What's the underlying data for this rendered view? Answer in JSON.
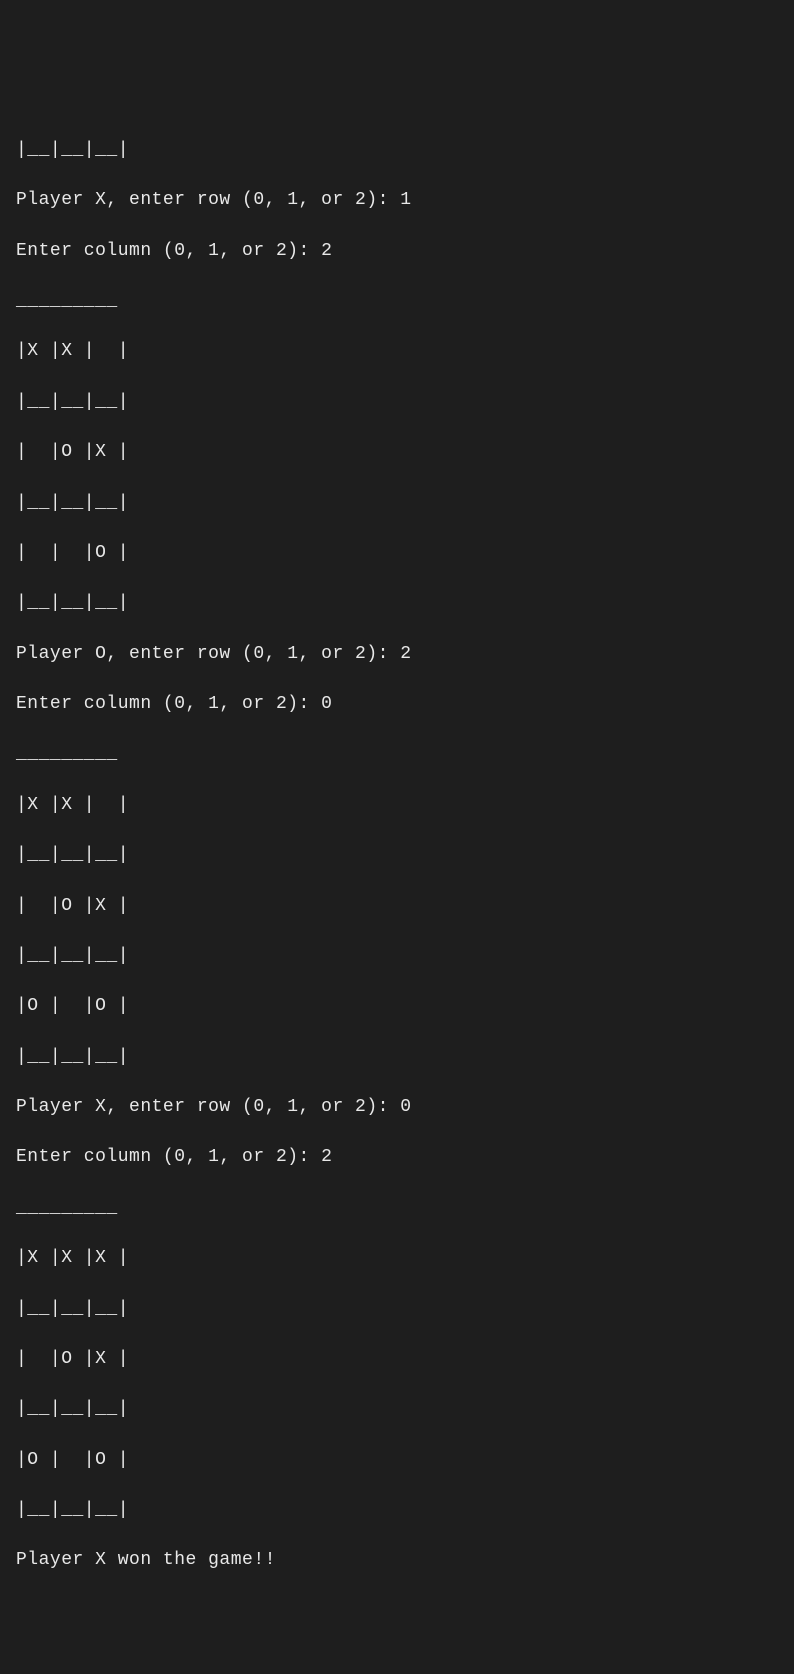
{
  "terminal": {
    "lines": [
      "|__|__|__|",
      "Player X, enter row (0, 1, or 2): 1",
      "Enter column (0, 1, or 2): 2",
      "_________",
      "|X |X |  |",
      "|__|__|__|",
      "|  |O |X |",
      "|__|__|__|",
      "|  |  |O |",
      "|__|__|__|",
      "Player O, enter row (0, 1, or 2): 2",
      "Enter column (0, 1, or 2): 0",
      "_________",
      "|X |X |  |",
      "|__|__|__|",
      "|  |O |X |",
      "|__|__|__|",
      "|O |  |O |",
      "|__|__|__|",
      "Player X, enter row (0, 1, or 2): 0",
      "Enter column (0, 1, or 2): 2",
      "_________",
      "|X |X |X |",
      "|__|__|__|",
      "|  |O |X |",
      "|__|__|__|",
      "|O |  |O |",
      "|__|__|__|",
      "Player X won the game!!"
    ]
  }
}
